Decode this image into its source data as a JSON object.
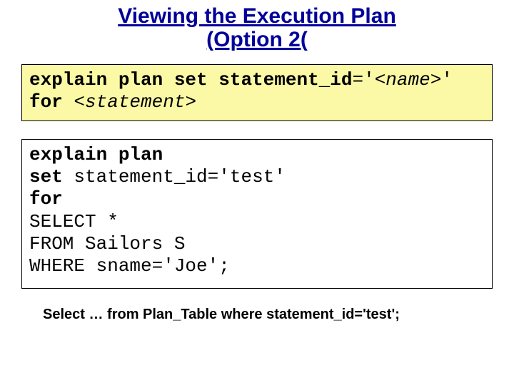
{
  "title": {
    "line1": "Viewing the Execution Plan",
    "line2": "(Option 2("
  },
  "syntax_box": {
    "l1_a": "explain plan set statement_id",
    "l1_b": "='",
    "l1_c": "<name>",
    "l1_d": "'",
    "l2_a": "for ",
    "l2_b": "<statement>"
  },
  "example_box": {
    "l1": "explain plan",
    "l2_a": "set ",
    "l2_b": "statement_id='test'",
    "l3": "for",
    "l4": "SELECT *",
    "l5": "FROM Sailors S",
    "l6": "WHERE sname='Joe';"
  },
  "footer": "Select … from Plan_Table where statement_id='test';"
}
